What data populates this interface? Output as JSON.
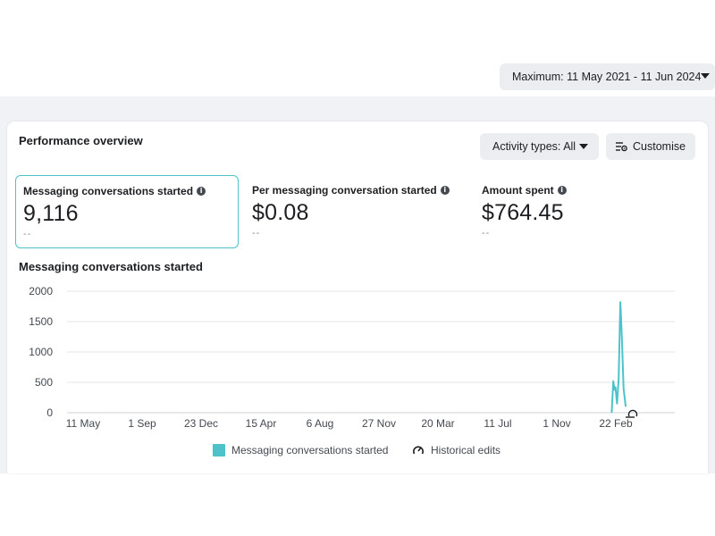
{
  "header": {
    "date_range_label": "Maximum: 11 May 2021 - 11 Jun 2024"
  },
  "card": {
    "title": "Performance overview",
    "activity_button_label": "Activity types: All",
    "customise_button_label": "Customise"
  },
  "metrics": [
    {
      "label": "Messaging conversations started",
      "value": "9,116",
      "compare": "--",
      "selected": true
    },
    {
      "label": "Per messaging conversation started",
      "value": "$0.08",
      "compare": "--",
      "selected": false
    },
    {
      "label": "Amount spent",
      "value": "$764.45",
      "compare": "--",
      "selected": false
    }
  ],
  "legend": {
    "series_label": "Messaging conversations started",
    "historical_label": "Historical edits"
  },
  "icons": {
    "info": "info-icon",
    "customise": "sliders-gear-icon",
    "dropdown": "caret-down-icon",
    "historical_edits": "gauge-edit-icon"
  },
  "colors": {
    "series": "#4dc3c9",
    "selected_border": "#4dc3c9",
    "background_band": "#f0f2f5"
  },
  "chart_data": {
    "type": "line",
    "title": "Messaging conversations started",
    "ylim": [
      0,
      2000
    ],
    "yticks": [
      0,
      500,
      1000,
      1500,
      2000
    ],
    "xtick_labels": [
      "11 May",
      "1 Sep",
      "23 Dec",
      "15 Apr",
      "6 Aug",
      "27 Nov",
      "20 Mar",
      "11 Jul",
      "1 Nov",
      "22 Feb"
    ],
    "grid": true,
    "series": [
      {
        "name": "Messaging conversations started",
        "x": [
          "2024-02-15",
          "2024-02-18",
          "2024-02-20",
          "2024-02-22",
          "2024-02-25",
          "2024-02-28",
          "2024-03-02",
          "2024-03-05",
          "2024-03-08",
          "2024-03-12"
        ],
        "values": [
          0,
          520,
          380,
          420,
          150,
          560,
          1820,
          1200,
          400,
          100
        ]
      }
    ]
  }
}
